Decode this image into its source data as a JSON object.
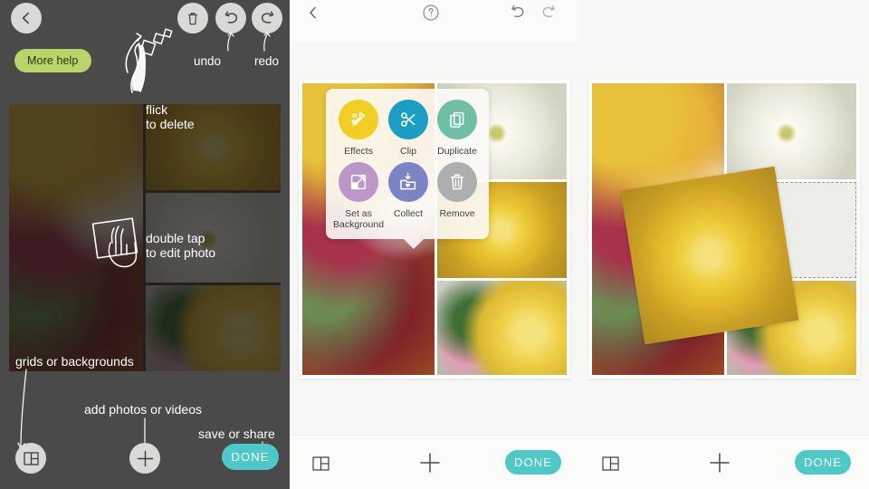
{
  "panels": {
    "tutorial": {
      "name": "tutorial-overlay-panel",
      "help_button_label": "More help",
      "top_icons": [
        {
          "name": "back-chevron-icon",
          "label": "back"
        },
        {
          "name": "trash-icon",
          "label": "delete"
        },
        {
          "name": "undo-icon",
          "label": "undo"
        },
        {
          "name": "redo-icon",
          "label": "redo"
        }
      ],
      "annotations": {
        "undo": "undo",
        "redo": "redo",
        "flick_line1": "flick",
        "flick_line2": "to delete",
        "double_tap_line1": "double tap",
        "double_tap_line2": "to edit photo",
        "grids": "grids or backgrounds",
        "add_photos": "add photos or videos",
        "save_share": "save or share"
      },
      "bottom": {
        "grid_icon": "grid-layout-icon",
        "add_icon": "plus-icon",
        "done_label": "DONE"
      }
    },
    "context_menu_panel": {
      "name": "collage-editor-with-context-menu",
      "top_icons": [
        {
          "name": "back-chevron-icon"
        },
        {
          "name": "help-question-icon"
        },
        {
          "name": "undo-icon"
        },
        {
          "name": "redo-icon"
        }
      ],
      "menu": {
        "items": [
          {
            "label": "Effects",
            "icon": "magic-wand-icon",
            "color": "#f1ce22"
          },
          {
            "label": "Clip",
            "icon": "scissors-icon",
            "color": "#1a9ec4"
          },
          {
            "label": "Duplicate",
            "icon": "duplicate-copy-icon",
            "color": "#6fbfa6"
          },
          {
            "label": "Set as\nBackground",
            "icon": "expand-to-background-icon",
            "color": "#bb96c8"
          },
          {
            "label": "Collect",
            "icon": "save-to-folder-icon",
            "color": "#7b84c4"
          },
          {
            "label": "Remove",
            "icon": "trash-icon",
            "color": "#aeaeae"
          }
        ]
      },
      "bottom": {
        "grid_icon": "grid-layout-icon",
        "add_icon": "plus-icon",
        "done_label": "DONE"
      }
    },
    "result_panel": {
      "name": "collage-result-panel",
      "bottom": {
        "grid_icon": "grid-layout-icon",
        "add_icon": "plus-icon",
        "done_label": "DONE"
      },
      "empty_cell_name": "empty-collage-slot"
    }
  },
  "colors": {
    "dark_ui": "#4a4a4a",
    "done_teal": "#4ec8c8",
    "help_green": "#b9d468",
    "light_bg": "#f7f7f5"
  }
}
